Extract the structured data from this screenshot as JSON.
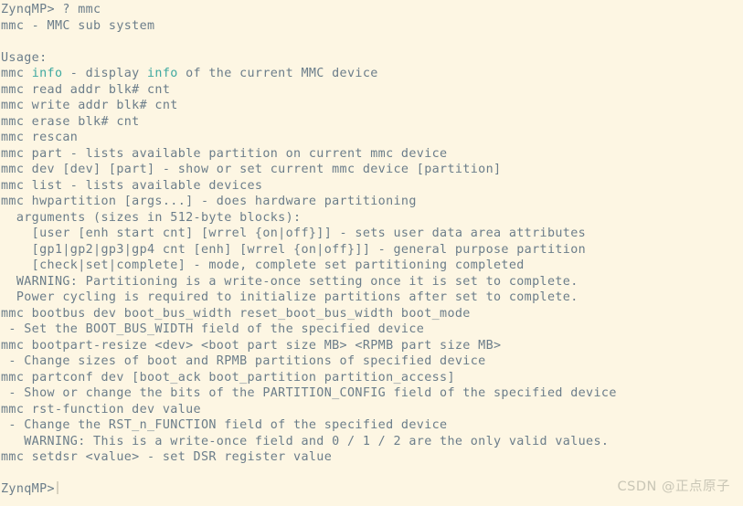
{
  "terminal": {
    "background_color": "#fdf6e3",
    "text_color": "#6b7d8a",
    "keyword_color": "#3fa9a0",
    "prompt": "ZynqMP>",
    "command": "? mmc",
    "lines": [
      {
        "text": "ZynqMP> ? mmc"
      },
      {
        "text": "mmc - MMC sub system"
      },
      {
        "text": ""
      },
      {
        "text": "Usage:"
      },
      {
        "pre": "mmc ",
        "kw": "info",
        "post": " - display ",
        "kw2": "info",
        "post2": " of the current MMC device"
      },
      {
        "text": "mmc read addr blk# cnt"
      },
      {
        "text": "mmc write addr blk# cnt"
      },
      {
        "text": "mmc erase blk# cnt"
      },
      {
        "text": "mmc rescan"
      },
      {
        "text": "mmc part - lists available partition on current mmc device"
      },
      {
        "text": "mmc dev [dev] [part] - show or set current mmc device [partition]"
      },
      {
        "text": "mmc list - lists available devices"
      },
      {
        "text": "mmc hwpartition [args...] - does hardware partitioning"
      },
      {
        "text": "  arguments (sizes in 512-byte blocks):"
      },
      {
        "text": "    [user [enh start cnt] [wrrel {on|off}]] - sets user data area attributes"
      },
      {
        "text": "    [gp1|gp2|gp3|gp4 cnt [enh] [wrrel {on|off}]] - general purpose partition"
      },
      {
        "text": "    [check|set|complete] - mode, complete set partitioning completed"
      },
      {
        "text": "  WARNING: Partitioning is a write-once setting once it is set to complete."
      },
      {
        "text": "  Power cycling is required to initialize partitions after set to complete."
      },
      {
        "text": "mmc bootbus dev boot_bus_width reset_boot_bus_width boot_mode"
      },
      {
        "text": " - Set the BOOT_BUS_WIDTH field of the specified device"
      },
      {
        "text": "mmc bootpart-resize <dev> <boot part size MB> <RPMB part size MB>"
      },
      {
        "text": " - Change sizes of boot and RPMB partitions of specified device"
      },
      {
        "text": "mmc partconf dev [boot_ack boot_partition partition_access]"
      },
      {
        "text": " - Show or change the bits of the PARTITION_CONFIG field of the specified device"
      },
      {
        "text": "mmc rst-function dev value"
      },
      {
        "text": " - Change the RST_n_FUNCTION field of the specified device"
      },
      {
        "text": "   WARNING: This is a write-once field and 0 / 1 / 2 are the only valid values."
      },
      {
        "text": "mmc setdsr <value> - set DSR register value"
      },
      {
        "text": ""
      },
      {
        "text": "ZynqMP>",
        "cursor": true
      }
    ]
  },
  "watermark": {
    "text": "CSDN @正点原子"
  }
}
